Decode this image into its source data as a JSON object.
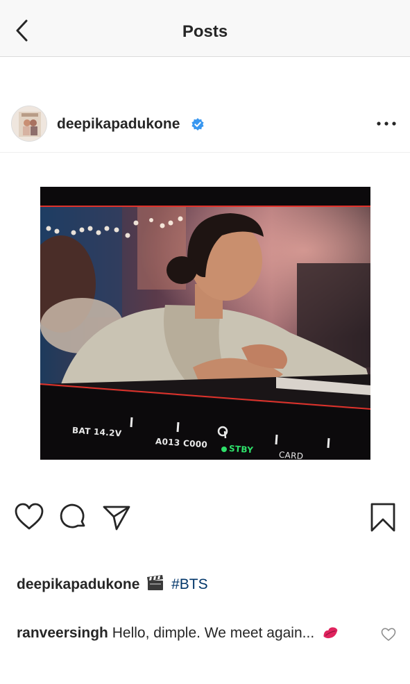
{
  "header": {
    "title": "Posts",
    "back_icon": "chevron-left-icon"
  },
  "post": {
    "username": "deepikapadukone",
    "verified_icon": "verified-badge-icon",
    "more_icon": "more-horizontal-icon",
    "avatar_icon": "profile-avatar",
    "photo": {
      "overlay": {
        "battery": "BAT 14.2V",
        "clip": "A013 C000",
        "status": "STBY",
        "card": "CARD"
      },
      "colors": {
        "frame_line": "#e0322b",
        "status_green": "#2ee06a"
      }
    },
    "actions": {
      "like_icon": "heart-icon",
      "comment_icon": "comment-icon",
      "share_icon": "paper-plane-icon",
      "save_icon": "bookmark-icon"
    },
    "caption": {
      "username": "deepikapadukone",
      "emoji_icon": "clapper-board-icon",
      "hashtag": "#BTS"
    },
    "comment": {
      "username": "ranveersingh",
      "text": "Hello, dimple. We meet again...",
      "emoji_icon": "kiss-mark-icon",
      "like_icon": "heart-icon"
    }
  },
  "colors": {
    "text": "#262626",
    "hashtag": "#003569",
    "verified_blue": "#3897f0",
    "divider": "#dbdbdb"
  }
}
